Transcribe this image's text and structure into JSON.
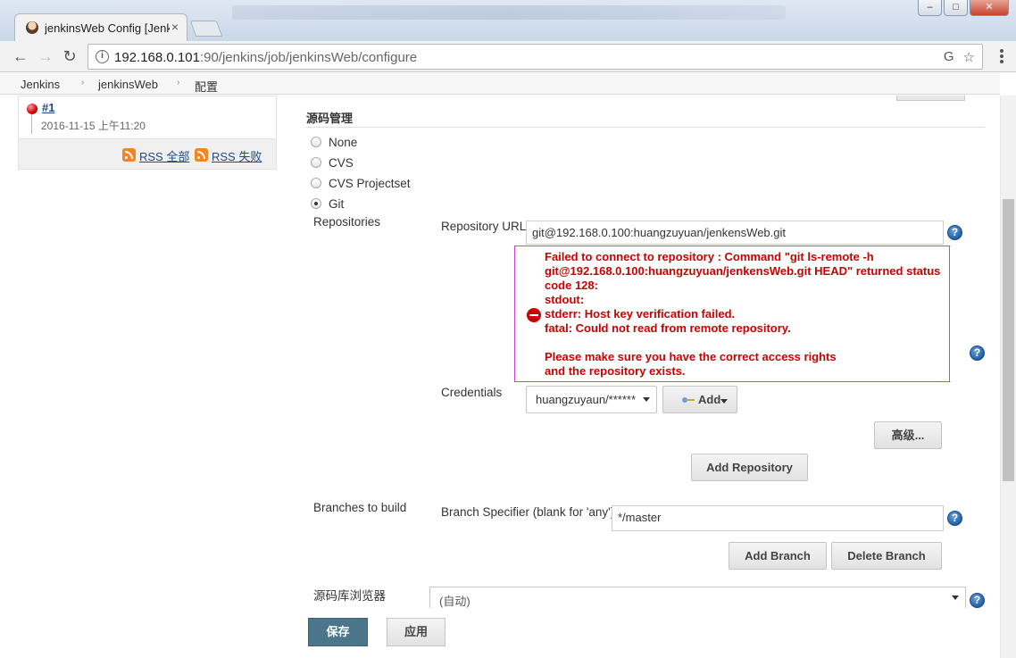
{
  "browser": {
    "tab_title": "jenkinsWeb Config [Jenkins]",
    "tab_close": "×",
    "url_host": "192.168.0.101",
    "url_rest": ":90/jenkins/job/jenkinsWeb/configure",
    "info_icon": "i",
    "translate_icon": "G",
    "star_icon": "☆",
    "back_icon": "←",
    "forward_icon": "→",
    "reload_icon": "↻",
    "win_min": "–",
    "win_max": "□",
    "win_close": "✕"
  },
  "breadcrumb": {
    "items": [
      "Jenkins",
      "jenkinsWeb",
      "配置"
    ],
    "separator": "›"
  },
  "sidebar": {
    "build_number": "#1",
    "build_date": "2016-11-15 上午11:20",
    "rss_all": "RSS 全部",
    "rss_failed": "RSS 失败"
  },
  "scm": {
    "section_title": "源码管理",
    "options": [
      {
        "label": "None",
        "checked": false
      },
      {
        "label": "CVS",
        "checked": false
      },
      {
        "label": "CVS Projectset",
        "checked": false
      },
      {
        "label": "Git",
        "checked": true
      }
    ],
    "repositories_label": "Repositories",
    "repo_url_label": "Repository URL",
    "repo_url_value": "git@192.168.0.100:huangzuyuan/jenkensWeb.git",
    "error_message": "Failed to connect to repository : Command \"git ls-remote -h\ngit@192.168.0.100:huangzuyuan/jenkensWeb.git HEAD\" returned status\ncode 128:\nstdout:\nstderr: Host key verification failed.\nfatal: Could not read from remote repository.\n\nPlease make sure you have the correct access rights\nand the repository exists.",
    "credentials_label": "Credentials",
    "credentials_value": "huangzuyaun/******",
    "add_label": "Add",
    "advanced_label": "高级...",
    "add_repository_label": "Add Repository",
    "branches_label": "Branches to build",
    "branch_specifier_label": "Branch Specifier (blank for 'any')",
    "branch_specifier_value": "*/master",
    "add_branch_label": "Add Branch",
    "delete_branch_label": "Delete Branch",
    "repo_browser_label": "源码库浏览器",
    "repo_browser_value": "(自动)",
    "help_icon": "?"
  },
  "actions": {
    "save": "保存",
    "apply": "应用"
  },
  "colors": {
    "error_red": "#cc0000",
    "error_border": "#d63bd6",
    "save_blue": "#4b758b",
    "link_blue": "#204a87"
  }
}
